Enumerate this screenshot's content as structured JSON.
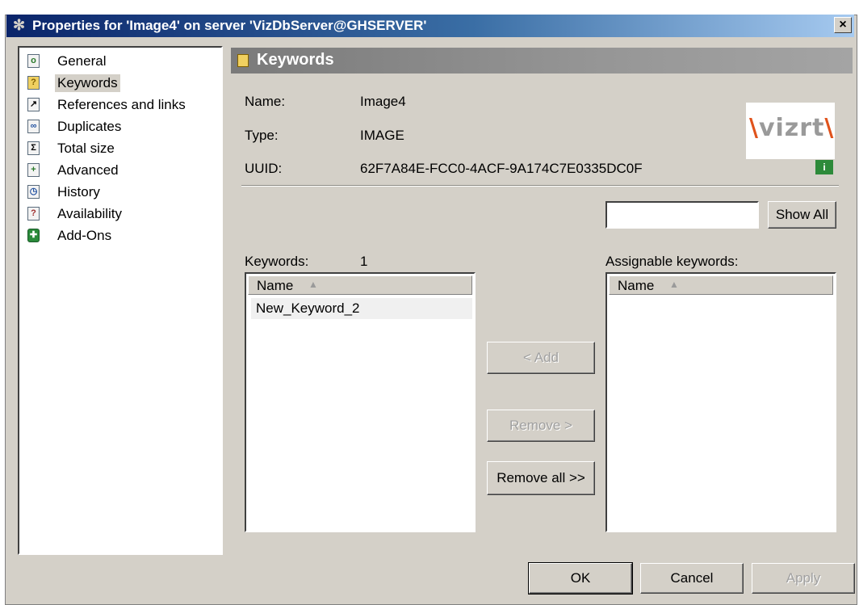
{
  "window": {
    "title": "Properties for 'Image4' on server 'VizDbServer@GHSERVER'",
    "close_label": "×"
  },
  "nav": {
    "items": [
      {
        "label": "General",
        "icon": "general-icon"
      },
      {
        "label": "Keywords",
        "icon": "keywords-icon",
        "selected": true
      },
      {
        "label": "References and links",
        "icon": "references-icon"
      },
      {
        "label": "Duplicates",
        "icon": "duplicates-icon"
      },
      {
        "label": "Total size",
        "icon": "total-size-icon"
      },
      {
        "label": "Advanced",
        "icon": "advanced-icon"
      },
      {
        "label": "History",
        "icon": "history-icon"
      },
      {
        "label": "Availability",
        "icon": "availability-icon"
      },
      {
        "label": "Add-Ons",
        "icon": "add-ons-icon"
      }
    ]
  },
  "section": {
    "title": "Keywords"
  },
  "info": {
    "name_label": "Name:",
    "name_value": "Image4",
    "type_label": "Type:",
    "type_value": "IMAGE",
    "uuid_label": "UUID:",
    "uuid_value": "62F7A84E-FCC0-4ACF-9A174C7E0335DC0F"
  },
  "logo": {
    "text": "vizrt"
  },
  "search": {
    "value": "",
    "show_all_label": "Show All"
  },
  "keywords": {
    "label": "Keywords:",
    "count": "1",
    "column": "Name",
    "rows": [
      "New_Keyword_2"
    ]
  },
  "assignable": {
    "label": "Assignable keywords:",
    "column": "Name",
    "rows": []
  },
  "actions": {
    "add_label": "<      Add",
    "remove_label": "Remove   >",
    "remove_all_label": "Remove all >>"
  },
  "footer": {
    "ok_label": "OK",
    "cancel_label": "Cancel",
    "apply_label": "Apply"
  },
  "colors": {
    "dialog_bg": "#d4d0c8",
    "title_start": "#0a246a",
    "title_end": "#a6caf0",
    "header_bg": "#7a7a7a",
    "logo_accent": "#e0531c"
  }
}
